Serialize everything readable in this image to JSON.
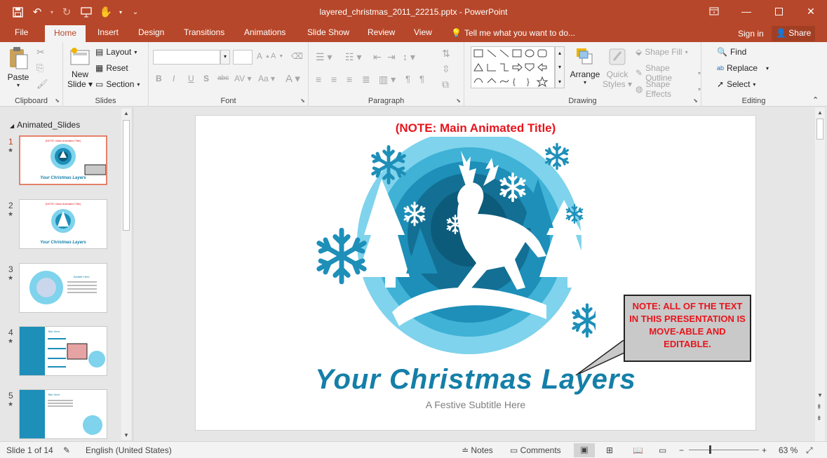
{
  "window": {
    "title": "layered_christmas_2011_22215.pptx - PowerPoint",
    "controls": [
      "ribbon-display",
      "minimize",
      "maximize",
      "close"
    ]
  },
  "tabs": {
    "file": "File",
    "home": "Home",
    "insert": "Insert",
    "design": "Design",
    "transitions": "Transitions",
    "animations": "Animations",
    "slideshow": "Slide Show",
    "review": "Review",
    "view": "View",
    "tellme": "Tell me what you want to do...",
    "signin": "Sign in",
    "share": "Share"
  },
  "ribbon": {
    "clipboard": {
      "label": "Clipboard",
      "paste": "Paste"
    },
    "slides": {
      "label": "Slides",
      "new_slide": "New",
      "new_slide2": "Slide",
      "layout": "Layout",
      "reset": "Reset",
      "section": "Section"
    },
    "font": {
      "label": "Font"
    },
    "paragraph": {
      "label": "Paragraph"
    },
    "drawing": {
      "label": "Drawing",
      "arrange": "Arrange",
      "quick_styles": "Quick",
      "quick_styles2": "Styles",
      "shape_fill": "Shape Fill",
      "shape_outline": "Shape Outline",
      "shape_effects": "Shape Effects"
    },
    "editing": {
      "label": "Editing",
      "find": "Find",
      "replace": "Replace",
      "select": "Select"
    }
  },
  "thumbpane": {
    "section": "Animated_Slides",
    "slides": [
      {
        "num": "1",
        "title": "Your Christmas Layers"
      },
      {
        "num": "2",
        "title": "Your Christmas Layers"
      },
      {
        "num": "3",
        "title": "Subtitle Here"
      },
      {
        "num": "4",
        "title": "Title Here"
      },
      {
        "num": "5",
        "title": "Title Here"
      }
    ]
  },
  "slide": {
    "note_title": "(NOTE: Main Animated Title)",
    "main_title": "Your Christmas Layers",
    "subtitle": "A Festive Subtitle Here",
    "callout": "NOTE: ALL OF THE TEXT IN THIS PRESENTATION IS MOVE-ABLE AND EDITABLE."
  },
  "status": {
    "slide_info": "Slide 1 of 14",
    "language": "English (United States)",
    "notes": "Notes",
    "comments": "Comments",
    "zoom": "63 %"
  },
  "colors": {
    "accent": "#b7472a",
    "ribbon_bg": "#f3f3f3",
    "note_red": "#e8141c",
    "title_blue": "#147fa8",
    "light_blue": "#7fd3ec",
    "dark_blue": "#0d5b7a"
  }
}
